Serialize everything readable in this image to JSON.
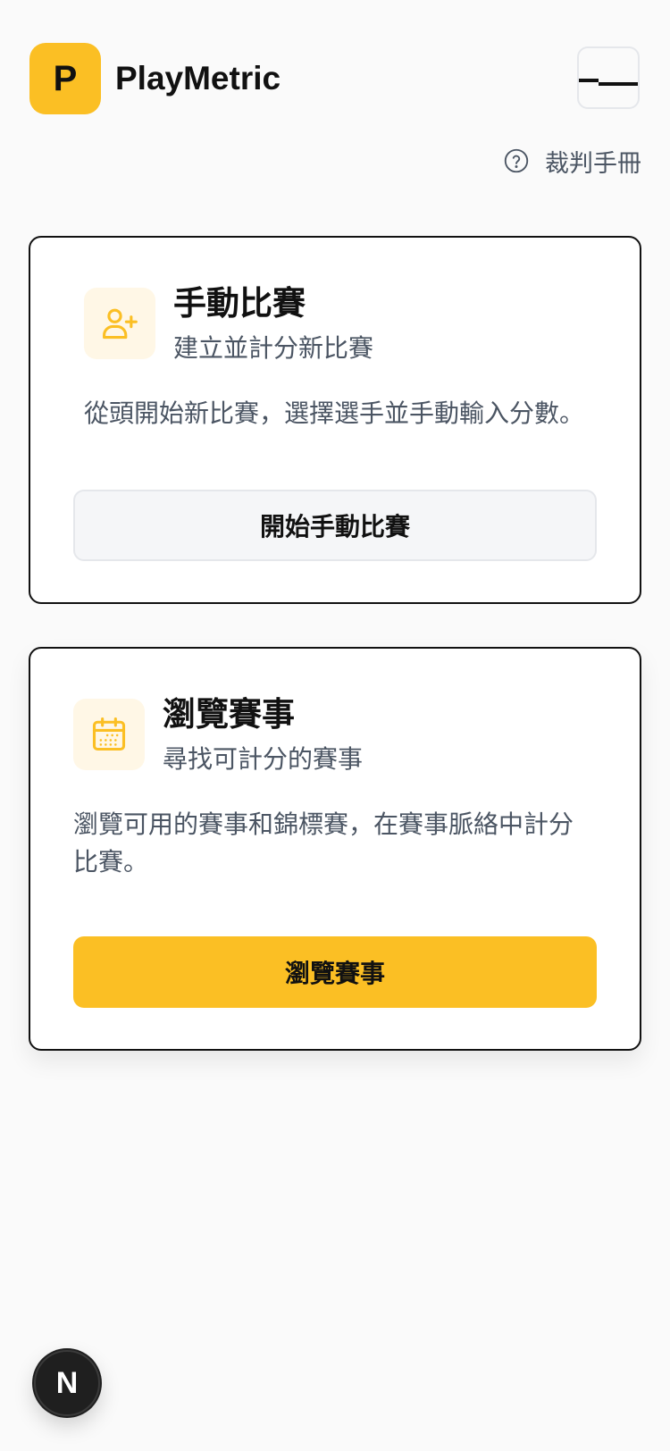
{
  "app": {
    "logo_letter": "P",
    "name": "PlayMetric"
  },
  "header": {
    "help_label": "裁判手冊"
  },
  "cards": [
    {
      "title": "手動比賽",
      "subtitle": "建立並計分新比賽",
      "description": "從頭開始新比賽，選擇選手並手動輸入分數。",
      "button_label": "開始手動比賽",
      "icon": "user-plus-icon"
    },
    {
      "title": "瀏覽賽事",
      "subtitle": "尋找可計分的賽事",
      "description": "瀏覽可用的賽事和錦標賽，在賽事脈絡中計分比賽。",
      "button_label": "瀏覽賽事",
      "icon": "calendar-icon"
    }
  ],
  "dev_badge": {
    "letter": "N"
  },
  "colors": {
    "accent": "#fbbf24",
    "accent_soft": "#fff7e6",
    "text_primary": "#111111",
    "text_secondary": "#4b5563",
    "border": "#e5e7eb",
    "background": "#fafafa"
  }
}
